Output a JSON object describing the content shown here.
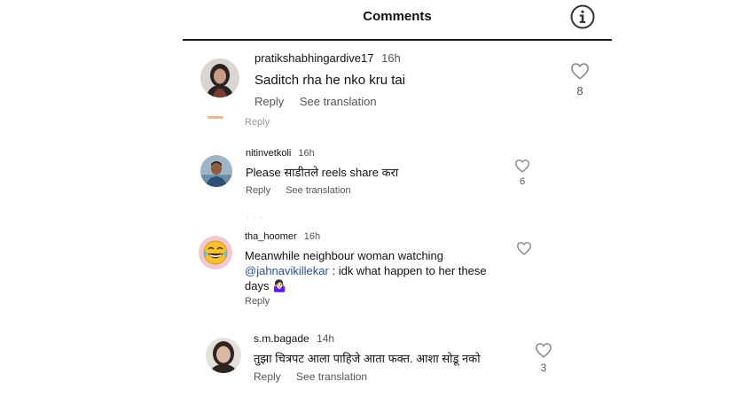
{
  "header": {
    "title": "Comments",
    "info_icon": "info-circle-icon"
  },
  "comments": [
    {
      "username": "pratikshabhingardive17",
      "time": "16h",
      "text": "Saditch rha he nko kru tai",
      "actions": [
        "Reply",
        "See translation"
      ],
      "likes": "8",
      "avatar": "woman-avatar"
    },
    {
      "username": "nitinvetkoli",
      "time": "16h",
      "text": "Please साडीतले reels share करा",
      "actions": [
        "Reply",
        "See translation"
      ],
      "likes": "6",
      "avatar": "man-avatar"
    },
    {
      "username": "tha_hoomer",
      "time": "16h",
      "text_before": "Meanwhile neighbour woman watching",
      "mention": "@jahnavikillekar",
      "text_after": " : idk what happen to her these days 🤷🏻‍♀️",
      "actions": [
        "Reply"
      ],
      "likes": "",
      "avatar": "laughing-emoji-avatar"
    },
    {
      "username": "s.m.bagade",
      "time": "14h",
      "text": "तुझा चित्रपट आला पाहिजे आता फक्त. आशा सोडू नको",
      "actions": [
        "Reply",
        "See translation"
      ],
      "likes": "3",
      "avatar": "woman-avatar"
    }
  ],
  "partial": {
    "reply_fragment": "Reply"
  },
  "colors": {
    "text": "#111111",
    "secondary": "#555555",
    "mention": "#2b4f8f",
    "icon": "#8a8a8a"
  }
}
